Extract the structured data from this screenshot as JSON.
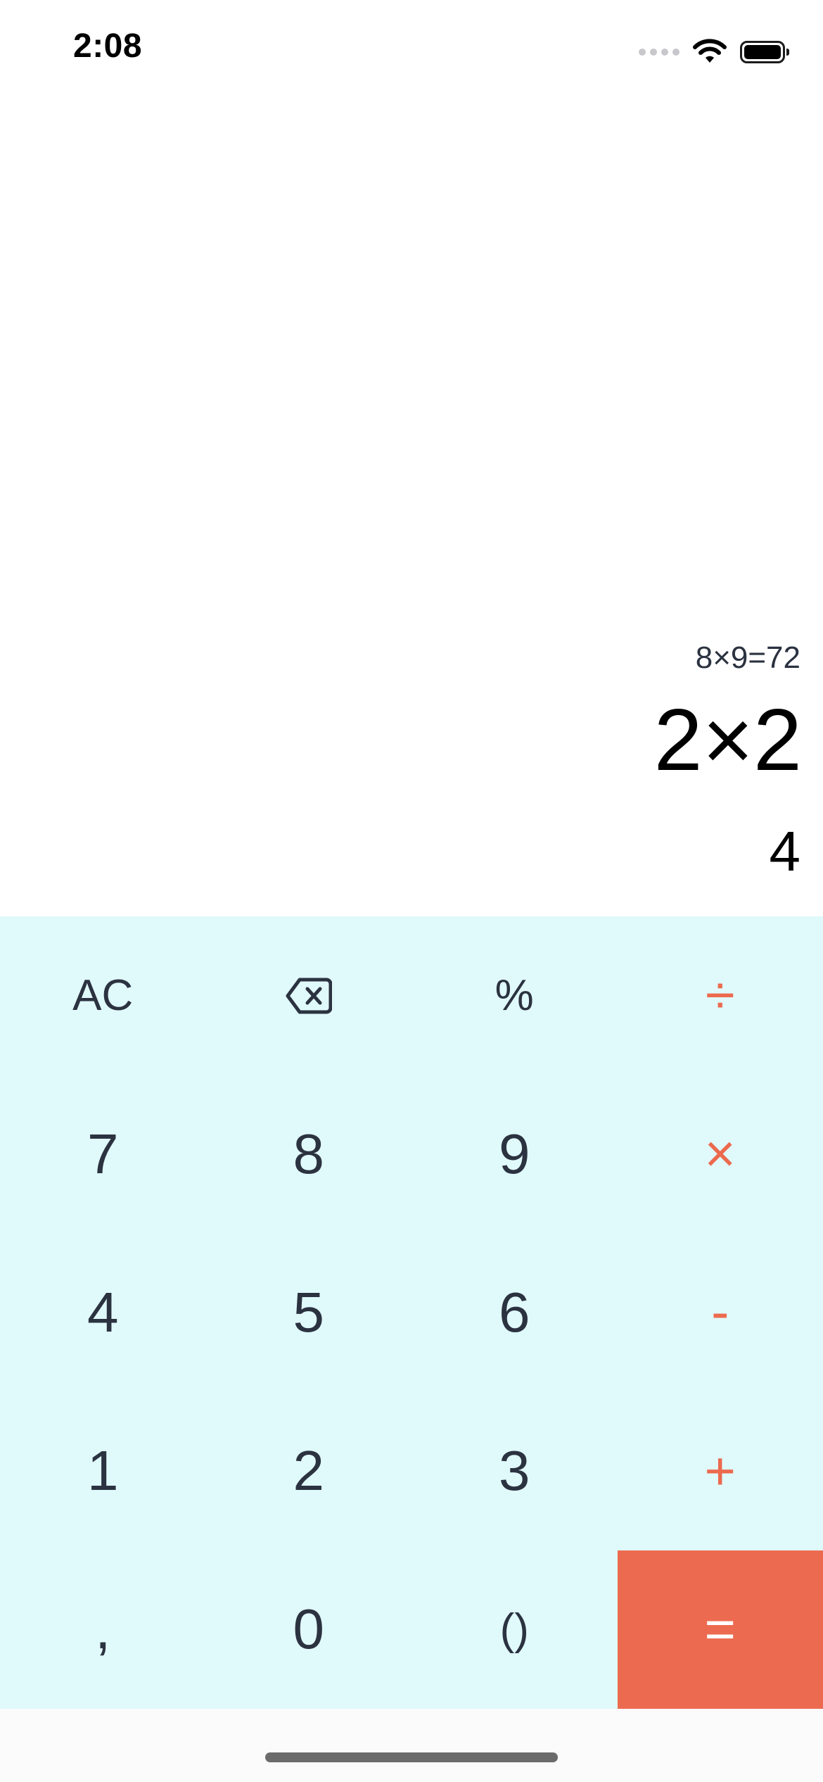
{
  "status_bar": {
    "time": "2:08",
    "icons": [
      "cellular-dots-icon",
      "wifi-icon",
      "battery-icon"
    ]
  },
  "display": {
    "history": "8×9=72",
    "expression": "2×2",
    "result": "4"
  },
  "keypad": {
    "clear": "AC",
    "backspace_icon": "backspace-icon",
    "percent": "%",
    "divide": "÷",
    "seven": "7",
    "eight": "8",
    "nine": "9",
    "multiply": "×",
    "four": "4",
    "five": "5",
    "six": "6",
    "subtract": "-",
    "one": "1",
    "two": "2",
    "three": "3",
    "add": "+",
    "comma": ",",
    "zero": "0",
    "parentheses": "()",
    "equals": "="
  },
  "colors": {
    "keypad_background": "#e0f9fa",
    "operator": "#ec6a4e",
    "equals_background": "#ec6b50",
    "digit_text": "#2b3240"
  }
}
